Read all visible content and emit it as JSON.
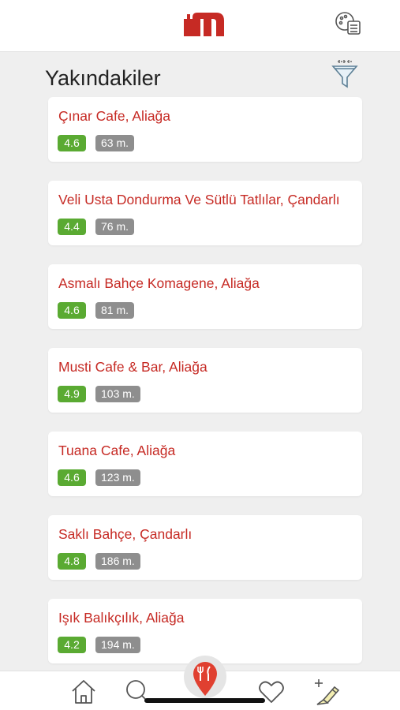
{
  "header": {
    "logo_icon": "brand-m-logo",
    "menu_icon": "menu-list-icon",
    "brand_color": "#c62a24"
  },
  "section": {
    "title": "Yakındakiler",
    "filter_icon": "filter-funnel-icon"
  },
  "places": [
    {
      "name": "Çınar Cafe, Aliağa",
      "rating": "4.6",
      "distance": "63 m."
    },
    {
      "name": "Veli Usta Dondurma Ve Sütlü Tatlılar, Çandarlı",
      "rating": "4.4",
      "distance": "76 m."
    },
    {
      "name": "Asmalı Bahçe Komagene, Aliağa",
      "rating": "4.6",
      "distance": "81 m."
    },
    {
      "name": "Musti Cafe & Bar, Aliağa",
      "rating": "4.9",
      "distance": "103 m."
    },
    {
      "name": "Tuana Cafe, Aliağa",
      "rating": "4.6",
      "distance": "123 m."
    },
    {
      "name": "Saklı Bahçe, Çandarlı",
      "rating": "4.8",
      "distance": "186 m."
    },
    {
      "name": "Işık Balıkçılık, Aliağa",
      "rating": "4.2",
      "distance": "194 m."
    }
  ],
  "colors": {
    "rating_badge": "#5aaa32",
    "distance_badge": "#8e8e8e",
    "place_name": "#c62a24"
  },
  "bottom_nav": {
    "items": [
      {
        "icon": "home-icon"
      },
      {
        "icon": "search-icon"
      },
      {
        "icon": "nearby-restaurant-pin-icon"
      },
      {
        "icon": "favorites-heart-icon"
      },
      {
        "icon": "add-review-icon"
      }
    ]
  }
}
